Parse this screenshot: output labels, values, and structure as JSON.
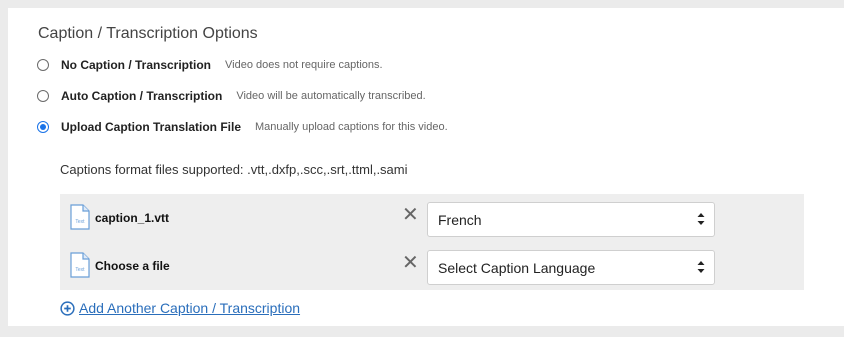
{
  "section": {
    "title": "Caption / Transcription Options"
  },
  "options": [
    {
      "label": "No Caption / Transcription",
      "description": "Video does not require captions.",
      "selected": false
    },
    {
      "label": "Auto Caption / Transcription",
      "description": "Video will be automatically transcribed.",
      "selected": false
    },
    {
      "label": "Upload Caption Translation File",
      "description": "Manually upload captions for this video.",
      "selected": true
    }
  ],
  "formats_text": "Captions format files supported: .vtt,.dxfp,.scc,.srt,.ttml,.sami",
  "files": [
    {
      "name": "caption_1.vtt",
      "icon": "text-file-icon",
      "remove_icon": "close-icon",
      "language": "French"
    },
    {
      "name": "Choose a file",
      "icon": "text-file-icon",
      "remove_icon": "close-icon",
      "language": "Select Caption Language"
    }
  ],
  "file_icon_label": "Text",
  "add_link": {
    "label": "Add Another Caption / Transcription",
    "icon": "plus-circle-icon"
  },
  "colors": {
    "accent": "#1a73e8",
    "link": "#2a6ebb",
    "file_box_bg": "#eeeeee"
  }
}
